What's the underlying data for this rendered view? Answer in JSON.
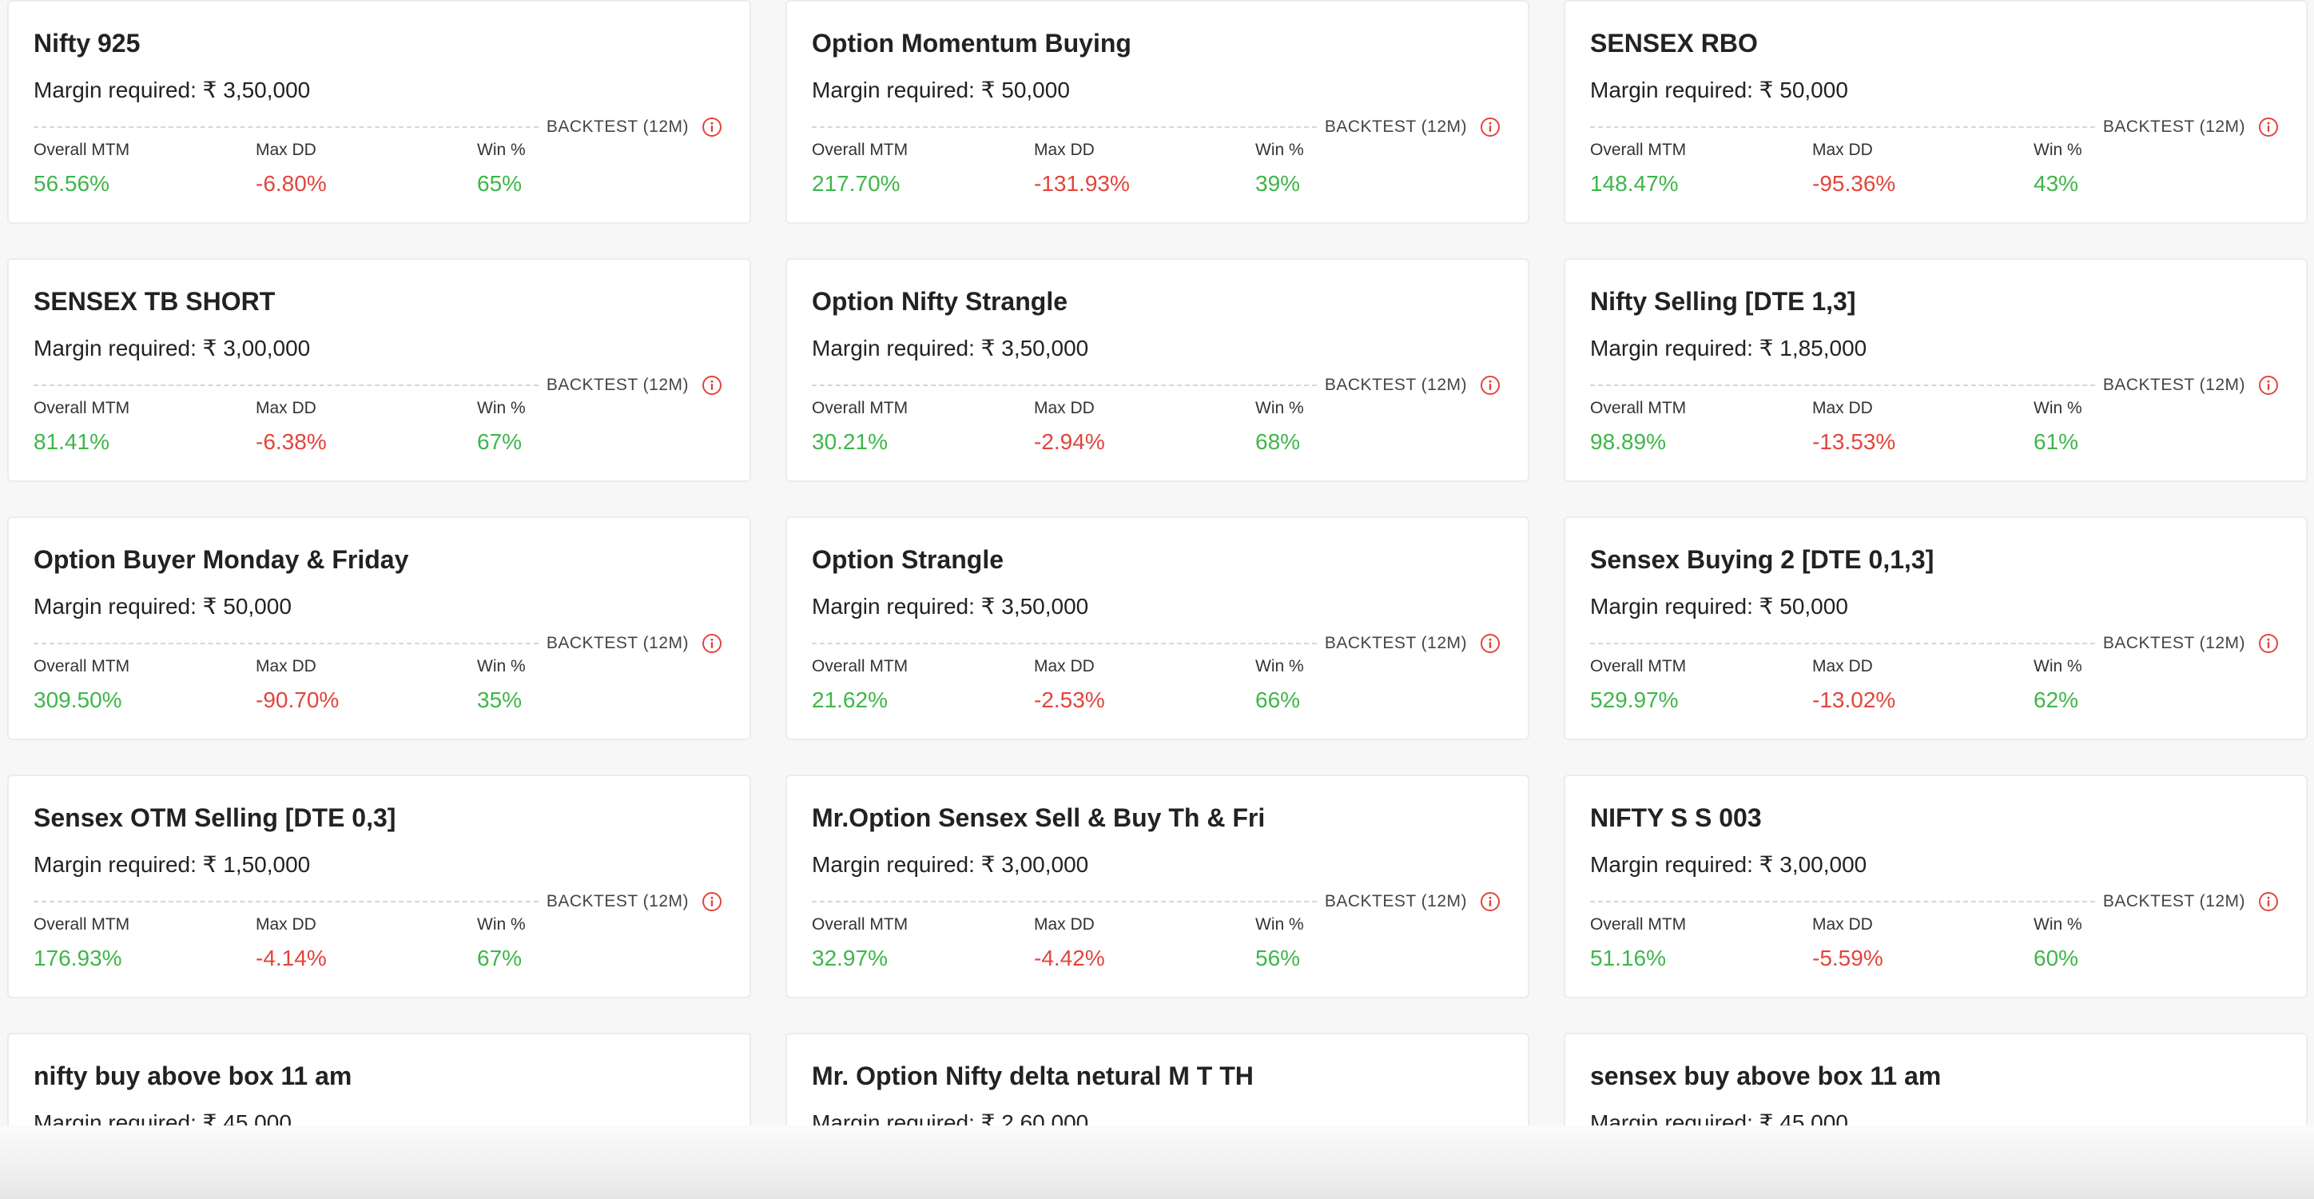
{
  "backtest_label": "BACKTEST (12M)",
  "stat_labels": {
    "overall": "Overall MTM",
    "maxdd": "Max DD",
    "win": "Win %"
  },
  "colors": {
    "positive": "#3fb64a",
    "negative": "#e2453c",
    "info_icon": "#e2453c"
  },
  "cards": [
    {
      "title": "Nifty 925",
      "margin": "Margin required: ₹ 3,50,000",
      "overall_mtm": "56.56%",
      "max_dd": "-6.80%",
      "win": "65%"
    },
    {
      "title": "Option Momentum Buying",
      "margin": "Margin required: ₹ 50,000",
      "overall_mtm": "217.70%",
      "max_dd": "-131.93%",
      "win": "39%"
    },
    {
      "title": "SENSEX RBO",
      "margin": "Margin required: ₹ 50,000",
      "overall_mtm": "148.47%",
      "max_dd": "-95.36%",
      "win": "43%"
    },
    {
      "title": "SENSEX TB SHORT",
      "margin": "Margin required: ₹ 3,00,000",
      "overall_mtm": "81.41%",
      "max_dd": "-6.38%",
      "win": "67%"
    },
    {
      "title": "Option Nifty Strangle",
      "margin": "Margin required: ₹ 3,50,000",
      "overall_mtm": "30.21%",
      "max_dd": "-2.94%",
      "win": "68%"
    },
    {
      "title": "Nifty Selling [DTE 1,3]",
      "margin": "Margin required: ₹ 1,85,000",
      "overall_mtm": "98.89%",
      "max_dd": "-13.53%",
      "win": "61%"
    },
    {
      "title": "Option Buyer Monday & Friday",
      "margin": "Margin required: ₹ 50,000",
      "overall_mtm": "309.50%",
      "max_dd": "-90.70%",
      "win": "35%"
    },
    {
      "title": "Option Strangle",
      "margin": "Margin required: ₹ 3,50,000",
      "overall_mtm": "21.62%",
      "max_dd": "-2.53%",
      "win": "66%"
    },
    {
      "title": "Sensex Buying 2 [DTE 0,1,3]",
      "margin": "Margin required: ₹ 50,000",
      "overall_mtm": "529.97%",
      "max_dd": "-13.02%",
      "win": "62%"
    },
    {
      "title": "Sensex OTM Selling [DTE 0,3]",
      "margin": "Margin required: ₹ 1,50,000",
      "overall_mtm": "176.93%",
      "max_dd": "-4.14%",
      "win": "67%"
    },
    {
      "title": "Mr.Option Sensex Sell & Buy Th & Fri",
      "margin": "Margin required: ₹ 3,00,000",
      "overall_mtm": "32.97%",
      "max_dd": "-4.42%",
      "win": "56%"
    },
    {
      "title": "NIFTY S S 003",
      "margin": "Margin required: ₹ 3,00,000",
      "overall_mtm": "51.16%",
      "max_dd": "-5.59%",
      "win": "60%"
    },
    {
      "title": "nifty buy above box 11 am",
      "margin": "Margin required: ₹ 45,000",
      "overall_mtm": "",
      "max_dd": "",
      "win": ""
    },
    {
      "title": "Mr. Option Nifty delta netural M T TH",
      "margin": "Margin required: ₹ 2,60,000",
      "overall_mtm": "",
      "max_dd": "",
      "win": ""
    },
    {
      "title": "sensex buy above box 11 am",
      "margin": "Margin required: ₹ 45,000",
      "overall_mtm": "",
      "max_dd": "",
      "win": ""
    }
  ]
}
